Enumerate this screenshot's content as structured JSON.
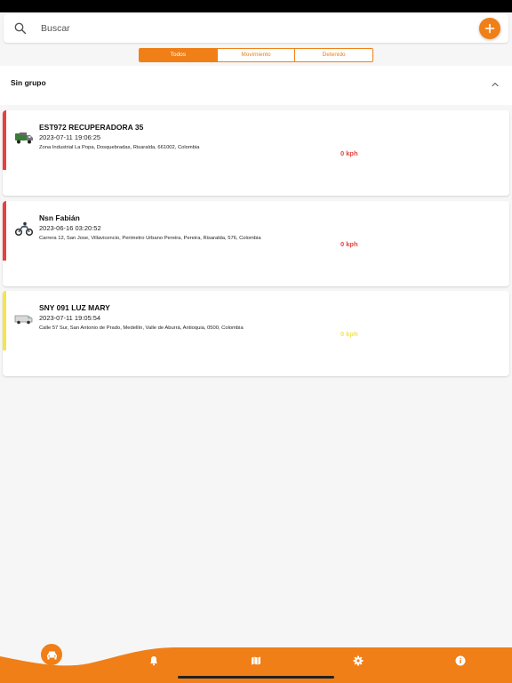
{
  "search": {
    "placeholder": "Buscar"
  },
  "filters": [
    {
      "label": "Todos",
      "active": true
    },
    {
      "label": "Movimiento",
      "active": false
    },
    {
      "label": "Detenido",
      "active": false
    }
  ],
  "group": {
    "title": "Sin grupo"
  },
  "vehicles": [
    {
      "name": "EST972 RECUPERADORA  35",
      "time": "2023-07-11 19:06:25",
      "address": "Zona Industrial La Popa, Dosquebradas, Risaralda, 661002, Colombia",
      "speed": "0 kph",
      "status_color": "#e8403c",
      "icon": "truck-icon"
    },
    {
      "name": "Nsn Fabián",
      "time": "2023-06-16 03:20:52",
      "address": "Carrera 12, San Jose, Villavicencio, Perimetro Urbano Pereira, Pereira, Risaralda, 576, Colombia",
      "speed": "0 kph",
      "status_color": "#e8403c",
      "icon": "motorcycle-icon"
    },
    {
      "name": "SNY 091 LUZ MARY",
      "time": "2023-07-11 19:05:54",
      "address": "Calle 57 Sur, San Antonio de Prado, Medellín, Valle de Aburrá, Antioquia, 0500, Colombia",
      "speed": "0 kph",
      "status_color": "#f3e54a",
      "icon": "van-icon"
    }
  ],
  "nav": [
    {
      "icon": "car-icon",
      "active": true
    },
    {
      "icon": "bell-icon",
      "active": false
    },
    {
      "icon": "map-icon",
      "active": false
    },
    {
      "icon": "gear-icon",
      "active": false
    },
    {
      "icon": "info-icon",
      "active": false
    }
  ],
  "colors": {
    "accent": "#f07f17",
    "stopped": "#e8403c",
    "idle": "#f3e54a"
  }
}
